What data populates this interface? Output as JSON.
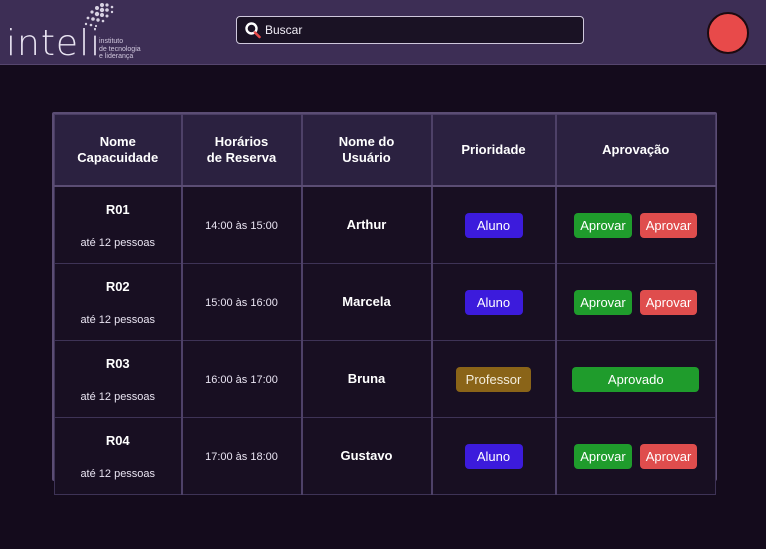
{
  "brand": {
    "name": "inteli",
    "tagline": "instituto\nde tecnologia\ne liderança"
  },
  "search": {
    "placeholder": "Buscar",
    "value": ""
  },
  "colors": {
    "header_bg": "#3d2e55",
    "page_bg": "#140b1c",
    "aluno_badge": "#3c1bdc",
    "professor_badge": "#8a6418",
    "approve": "#1f9c2c",
    "reject": "#df4d4d",
    "profile": "#e84a4a"
  },
  "table": {
    "headers": {
      "room": "Nome\nCapacuidade",
      "time": "Horários\nde Reserva",
      "user": "Nome do\nUsuário",
      "priority": "Prioridade",
      "approval": "Aprovação"
    },
    "rows": [
      {
        "code": "R01",
        "capacity": "até 12 pessoas",
        "time": "14:00 às 15:00",
        "user": "Arthur",
        "priority": "Aluno",
        "approve_label": "Aprovar",
        "reject_label": "Aprovar"
      },
      {
        "code": "R02",
        "capacity": "até 12 pessoas",
        "time": "15:00 às 16:00",
        "user": "Marcela",
        "priority": "Aluno",
        "approve_label": "Aprovar",
        "reject_label": "Aprovar"
      },
      {
        "code": "R03",
        "capacity": "até 12 pessoas",
        "time": "16:00 às 17:00",
        "user": "Bruna",
        "priority": "Professor",
        "approved_label": "Aprovado"
      },
      {
        "code": "R04",
        "capacity": "até 12 pessoas",
        "time": "17:00 às 18:00",
        "user": "Gustavo",
        "priority": "Aluno",
        "approve_label": "Aprovar",
        "reject_label": "Aprovar"
      }
    ]
  }
}
